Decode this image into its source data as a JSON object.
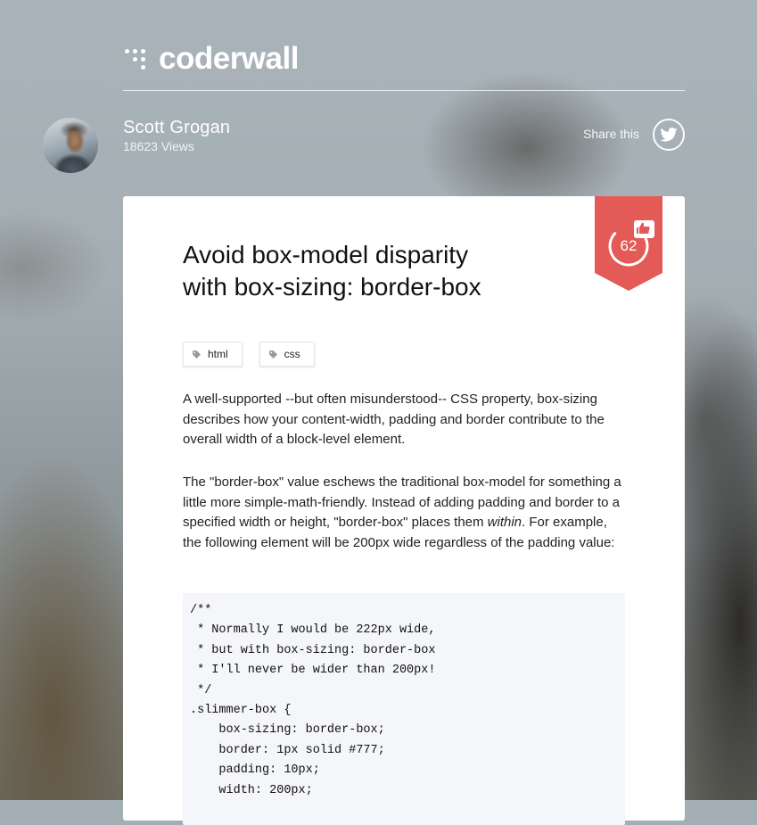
{
  "site": {
    "logo_text": "coderwall"
  },
  "author": {
    "name": "Scott Grogan",
    "views": "18623 Views"
  },
  "share": {
    "label": "Share this",
    "icon": "twitter-icon"
  },
  "protip": {
    "title_line1": "Avoid box-model disparity",
    "title_line2": "with box-sizing: border-box",
    "upvotes": "62",
    "badge_color": "#e35a57",
    "tags": [
      {
        "label": "html"
      },
      {
        "label": "css"
      }
    ],
    "paragraph1": "A well-supported --but often misunderstood-- CSS property, box-sizing describes how your content-width, padding and border contribute to the overall width of a block-level element.",
    "paragraph2_before": "The \"border-box\" value eschews the traditional box-model for something a little more simple-math-friendly. Instead of adding padding and border to a specified width or height, \"border-box\" places them ",
    "paragraph2_em": "within",
    "paragraph2_after": ". For example, the following element will be 200px wide regardless of the padding value:",
    "code_lines": [
      "/**",
      " * Normally I would be 222px wide,",
      " * but with box-sizing: border-box",
      " * I'll never be wider than 200px!",
      " */",
      ".slimmer-box {",
      "    box-sizing: border-box;",
      "    border: 1px solid #777;",
      "    padding: 10px;",
      "    width: 200px;"
    ]
  }
}
